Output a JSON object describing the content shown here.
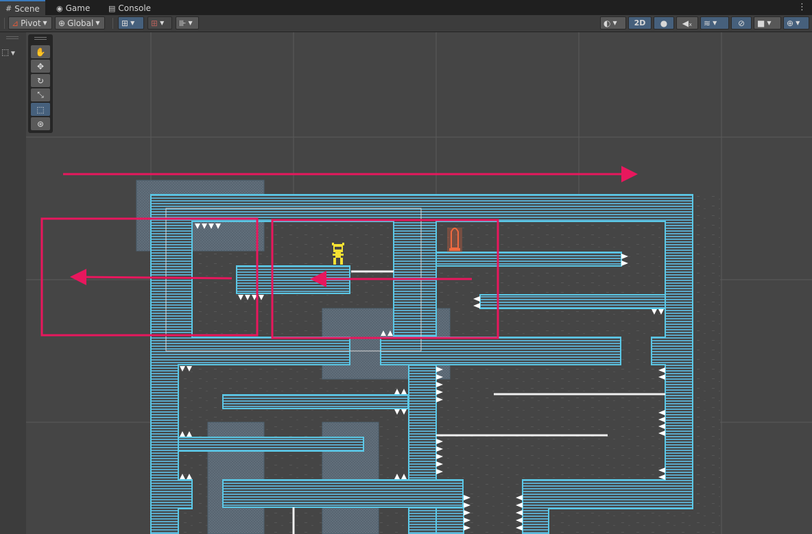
{
  "tabs": [
    {
      "icon": "scene-grid-icon",
      "label": "Scene"
    },
    {
      "icon": "gamepad-icon",
      "label": "Game"
    },
    {
      "icon": "console-icon",
      "label": "Console"
    }
  ],
  "toolbar": {
    "pivot_label": "Pivot",
    "global_label": "Global",
    "mode_2d_label": "2D"
  },
  "tools": [
    "hand-tool-icon",
    "move-tool-icon",
    "rotate-tool-icon",
    "scale-tool-icon",
    "rect-tool-icon",
    "transform-tool-icon"
  ],
  "active_tool": "rect-tool-icon",
  "colors": {
    "viewport_bg": "#454545",
    "tile_outline": "#5bc8e6",
    "tile_stripe": "#5a9fc0",
    "annotation": "#e8175d",
    "player": "#f5e133",
    "goal": "#f0603a"
  }
}
